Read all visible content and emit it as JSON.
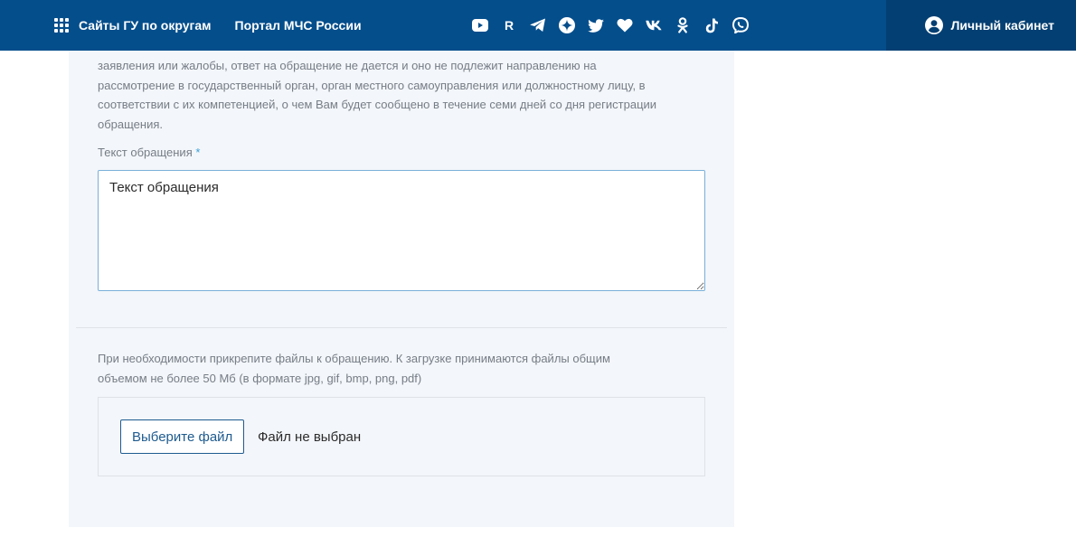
{
  "header": {
    "nav": {
      "regions_label": "Сайты ГУ по округам",
      "portal_label": "Портал МЧС России"
    },
    "social_icons": [
      {
        "name": "youtube-icon"
      },
      {
        "name": "rutube-icon",
        "text": "R"
      },
      {
        "name": "telegram-icon"
      },
      {
        "name": "dzen-icon"
      },
      {
        "name": "twitter-icon"
      },
      {
        "name": "heart-icon"
      },
      {
        "name": "vk-icon"
      },
      {
        "name": "odnoklassniki-icon"
      },
      {
        "name": "tiktok-icon"
      },
      {
        "name": "viber-icon"
      }
    ],
    "account_label": "Личный кабинет"
  },
  "form": {
    "notice": "заявления или жалобы, ответ на обращение не дается и оно не подлежит направлению на рассмотрение в государственный орган, орган местного самоуправления или должностному лицу, в соответствии с их компетенцией, о чем Вам будет сообщено в течение семи дней со дня регистрации обращения.",
    "message_label": "Текст обращения",
    "required_mark": "*",
    "message_placeholder": "Текст обращения",
    "attach_note": "При необходимости прикрепите файлы к обращению. К загрузке принимаются файлы общим объемом не более 50 Мб (в формате jpg, gif, bmp, png, pdf)",
    "file_button_label": "Выберите файл",
    "file_status": "Файл не выбран"
  },
  "colors": {
    "header_bg": "#044e8c",
    "account_bg": "#033f72",
    "panel_bg": "#f3f6fa",
    "accent": "#1e5b8f"
  }
}
